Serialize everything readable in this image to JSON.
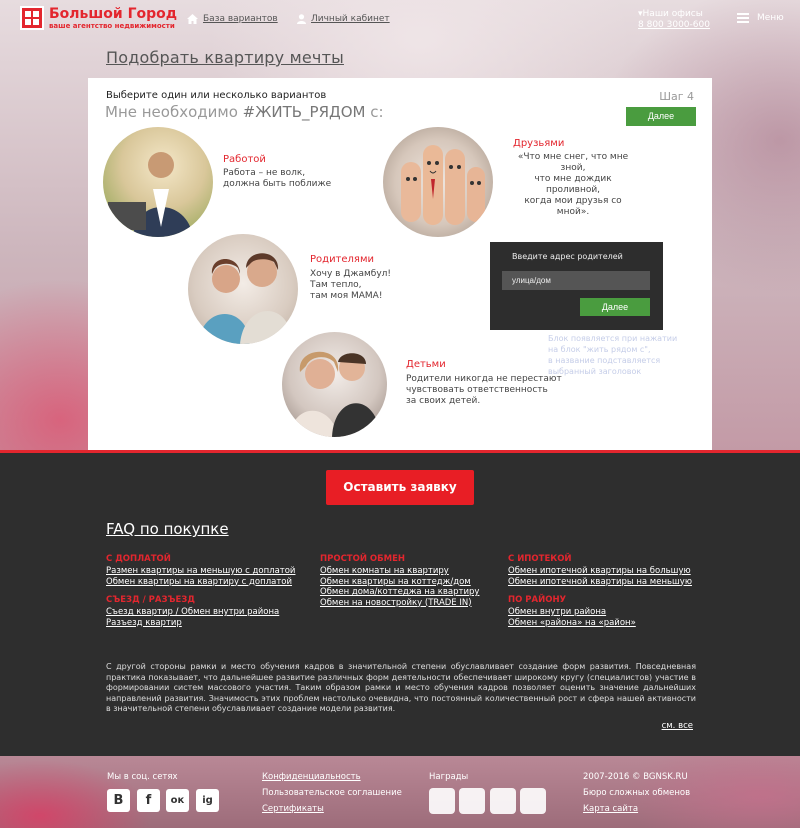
{
  "header": {
    "logo_name": "Большой Город",
    "logo_sub": "ваше агентство недвижимости",
    "nav_base": "База вариантов",
    "nav_cabinet": "Личный кабинет",
    "offices_label": "Наши офисы",
    "phone": "8 800 3000-600",
    "menu_label": "Меню"
  },
  "page_title": "Подобрать квартиру мечты",
  "card": {
    "subtitle": "Выберите один или несколько вариантов",
    "heading_prefix": "Мне необходимо ",
    "heading_tag": "#ЖИТЬ_РЯДОМ",
    "heading_suffix": " с:",
    "step": "Шаг 4",
    "next_label": "Далее",
    "options": [
      {
        "title": "Работой",
        "text": "Работа – не волк,\nдолжна быть поближе"
      },
      {
        "title": "Друзьями",
        "text": "«Что мне снег, что мне зной,\nчто мне дождик проливной,\nкогда мои друзья со мной»."
      },
      {
        "title": "Родителями",
        "text": "Хочу в Джамбул!\nТам тепло,\nтам моя МАМА!"
      },
      {
        "title": "Детьми",
        "text": "Родители никогда не перестают\nчувствовать ответственность\nза своих детей."
      }
    ],
    "popup": {
      "label": "Введите адрес родителей",
      "input_value": "улица/дом",
      "next_label": "Далее"
    },
    "popup_note": "Блок появляется при нажатии\nна блок \"жить рядом с\",\nв название подставляется\nвыбранный заголовок"
  },
  "cta_label": "Оставить заявку",
  "faq": {
    "title": "FAQ по покупке",
    "columns": [
      {
        "groups": [
          {
            "category": "С ДОПЛАТОЙ",
            "links": [
              "Размен квартиры на меньшую с доплатой",
              "Обмен квартиры на квартиру с доплатой"
            ]
          },
          {
            "category": "СЪЕЗД / РАЗЪЕЗД",
            "links": [
              "Съезд квартир / Обмен внутри района",
              "Разъезд квартир"
            ]
          }
        ]
      },
      {
        "groups": [
          {
            "category": "ПРОСТОЙ ОБМЕН",
            "links": [
              "Обмен комнаты на квартиру",
              "Обмен квартиры на коттедж/дом",
              "Обмен дома/коттеджа на квартиру",
              "Обмен на новостройку (TRADE IN)"
            ]
          }
        ]
      },
      {
        "groups": [
          {
            "category": "С ИПОТЕКОЙ",
            "links": [
              "Обмен ипотечной квартиры на большую",
              "Обмен ипотечной квартиры на меньшую"
            ]
          },
          {
            "category": "ПО РАЙОНУ",
            "links": [
              "Обмен внутри района",
              "Обмен «района» на «район»"
            ]
          }
        ]
      }
    ],
    "long_text": "С другой стороны рамки и место обучения кадров в значительной степени обуславливает создание форм развития. Повседневная практика показывает, что дальнейшее развитие различных форм деятельности обеспечивает широкому кругу (специалистов) участие в формировании систем массового участия. Таким образом рамки и место обучения кадров позволяет оценить значение дальнейших направлений развития. Значимость этих проблем настолько очевидна, что постоянный количественный рост и сфера нашей активности в значительной степени обуславливает создание модели развития.",
    "see_all": "см. все"
  },
  "footer": {
    "social_label": "Мы в соц. сетях",
    "social": [
      "В",
      "f",
      "ок",
      "ig"
    ],
    "links": [
      "Конфиденциальность",
      "Пользовательское соглашение",
      "Сертификаты"
    ],
    "awards_label": "Награды",
    "copyright": "2007-2016 © BGNSK.RU",
    "bureau": "Бюро сложных обменов",
    "sitemap": "Карта сайта"
  }
}
